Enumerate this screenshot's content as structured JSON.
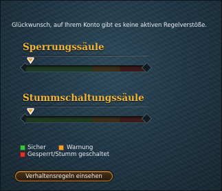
{
  "message": "Glückwunsch, auf Ihrem Konto gibt es keine aktiven Regelverstöße.",
  "sections": [
    {
      "title": "Sperrungssäule",
      "level": 0.0
    },
    {
      "title": "Stummschaltungssäule",
      "level": 0.0
    }
  ],
  "legend": {
    "items": [
      {
        "label": "Sicher",
        "color": "#3fbf3f"
      },
      {
        "label": "Warnung",
        "color": "#f0a030"
      },
      {
        "label": "Gesperrt/Stumm geschaltet",
        "color": "#e03030"
      }
    ]
  },
  "button": {
    "label": "Verhaltensregeln einsehen"
  },
  "colors": {
    "title": "#f2b63a",
    "background": "#1e3444",
    "button_border": "#c68a2c"
  }
}
